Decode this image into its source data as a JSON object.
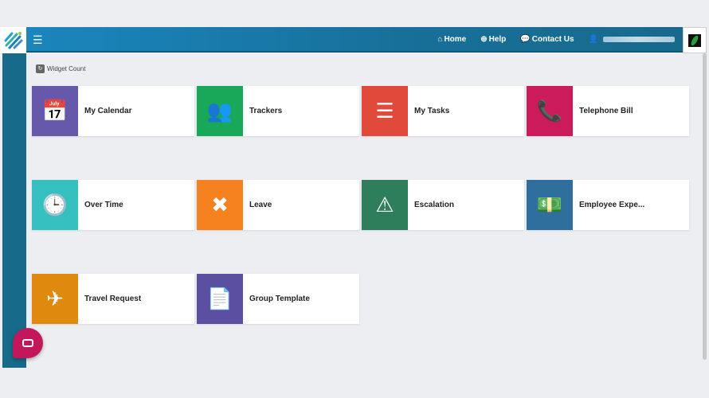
{
  "header": {
    "home": "Home",
    "help": "Help",
    "contact": "Contact Us",
    "menu_icon": "hamburger-icon"
  },
  "widget_count": "Widget Count",
  "tiles": [
    {
      "label": "My Calendar",
      "color": "#6659ab",
      "icon": "📅"
    },
    {
      "label": "Trackers",
      "color": "#19a859",
      "icon": "👥"
    },
    {
      "label": "My Tasks",
      "color": "#e1493a",
      "icon": "☰"
    },
    {
      "label": "Telephone Bill",
      "color": "#cc1b5b",
      "icon": "📞"
    },
    {
      "label": "Over Time",
      "color": "#36bfbf",
      "icon": "🕒"
    },
    {
      "label": "Leave",
      "color": "#f5821f",
      "icon": "✖"
    },
    {
      "label": "Escalation",
      "color": "#2e7d5b",
      "icon": "⚠"
    },
    {
      "label": "Employee Expe...",
      "color": "#2f6f9d",
      "icon": "💵"
    },
    {
      "label": "Travel Request",
      "color": "#df8a0f",
      "icon": "✈"
    },
    {
      "label": "Group Template",
      "color": "#5a4fa0",
      "icon": "📄"
    }
  ]
}
